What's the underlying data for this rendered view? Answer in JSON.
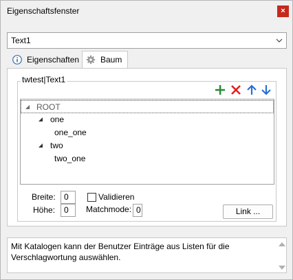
{
  "window": {
    "title": "Eigenschaftsfenster",
    "close_label": "×"
  },
  "combo": {
    "value": "Text1"
  },
  "tabs": [
    {
      "label": "Eigenschaften",
      "icon": "info-icon"
    },
    {
      "label": "Baum",
      "icon": "gear-icon",
      "active": true
    }
  ],
  "group": {
    "legend": "twtest|Text1"
  },
  "toolbar": [
    "add-icon",
    "delete-icon",
    "move-up-icon",
    "move-down-icon"
  ],
  "tree": [
    {
      "label": "ROOT",
      "level": 0,
      "expanded": true,
      "selected": true
    },
    {
      "label": "one",
      "level": 1,
      "expanded": true
    },
    {
      "label": "one_one",
      "level": 2
    },
    {
      "label": "two",
      "level": 1,
      "expanded": true
    },
    {
      "label": "two_one",
      "level": 2
    }
  ],
  "fields": {
    "breite_label": "Breite:",
    "breite_value": "0",
    "hoehe_label": "Höhe:",
    "hoehe_value": "0",
    "validieren_label": "Validieren",
    "matchmode_label": "Matchmode:",
    "matchmode_value": "0",
    "link_label": "Link ..."
  },
  "info": {
    "text": "Mit Katalogen kann der Benutzer Einträge aus Listen für die Verschlagwortung auswählen."
  },
  "colors": {
    "close": "#c42b1c",
    "add": "#2e8b3a",
    "delete": "#e02020",
    "arrows": "#2a6fd6"
  }
}
